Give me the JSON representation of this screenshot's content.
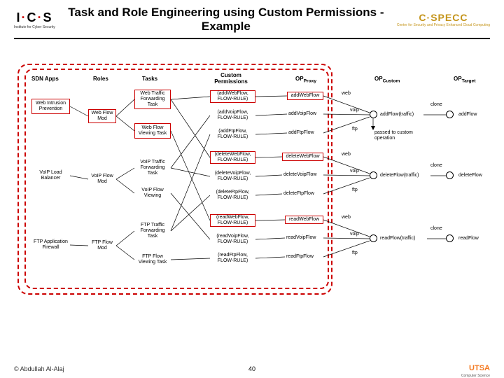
{
  "header": {
    "logo_left": "I·C·S",
    "logo_left_sub": "Institute for Cyber Security",
    "title": "Task and Role Engineering using Custom Permissions - Example",
    "logo_right": "C·SPECC",
    "logo_right_sub": "Center for Security and Privacy Enhanced Cloud Computing"
  },
  "cols": {
    "sdn": "SDN Apps",
    "roles": "Roles",
    "tasks": "Tasks",
    "perms": "Custom Permissions",
    "opproxy": "OPProxy",
    "opcustom": "OPCustom",
    "optarget": "OPTarget"
  },
  "sdn": {
    "web": "Web Intrusion Prevention",
    "voip": "VoIP Load Balancer",
    "ftp": "FTP Application Firewall"
  },
  "roles": {
    "web": "Web Flow Mod",
    "voip": "VoIP Flow Mod",
    "ftp": "FTP Flow Mod"
  },
  "tasks": {
    "webfwd": "Web Traffic Forwarding Task",
    "webview": "Web Flow Viewing Task",
    "voipfwd": "VoIP Traffic Forwarding Task",
    "voipview": "VoIP Flow Viewing",
    "ftpfwd": "FTP Traffic Forwarding Task",
    "ftpview": "FTP Flow Viewing Task"
  },
  "perms": {
    "addweb": "(addWebFlow, FLOW-RULE)",
    "addvoip": "(addVoipFlow, FLOW-RULE)",
    "addftp": "(addFtpFlow, FLOW-RULE)",
    "delweb": "(deleteWebFlow, FLOW-RULE)",
    "delvoip": "(deleteVoipFlow, FLOW-RULE)",
    "delftp": "(deleteFtpFlow, FLOW-RULE)",
    "readweb": "(readWebFlow, FLOW-RULE)",
    "readvoip": "(readVoipFlow, FLOW-RULE)",
    "readftp": "(readFtpFlow, FLOW-RULE)"
  },
  "proxy": {
    "addweb": "addWebFlow",
    "addvoip": "addVoipFlow",
    "addftp": "addFtpFlow",
    "delweb": "deleteWebFlow",
    "delvoip": "deleteVoipFlow",
    "delftp": "deleteFtpFlow",
    "readweb": "readWebFlow",
    "readvoip": "readVoipFlow",
    "readftp": "readFtpFlow"
  },
  "edge": {
    "web": "web",
    "voip": "voip",
    "ftp": "ftp"
  },
  "custom": {
    "add": "addFlow(traffic)",
    "del": "deleteFlow(traffic)",
    "read": "readFlow(traffic)"
  },
  "target": {
    "add": "addFlow",
    "del": "deleteFlow",
    "read": "readFlow"
  },
  "misc": {
    "clone": "clone",
    "passed": "passed to custom operation"
  },
  "footer": {
    "author": "© Abdullah Al-Alaj",
    "page": "40",
    "utsa": "UTSA",
    "utsa_sub": "Computer Science"
  }
}
